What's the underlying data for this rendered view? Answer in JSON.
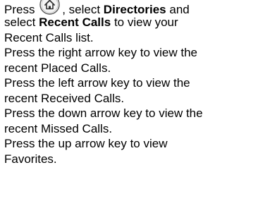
{
  "instructions": {
    "line1": {
      "press": "Press",
      "after_icon": ", select",
      "directories": "Directories",
      "and": "and"
    },
    "line2": {
      "select": "select",
      "recent_calls": "Recent Calls",
      "rest": "to view your"
    },
    "line3": "Recent Calls list.",
    "line4": "Press the right arrow key to view the",
    "line5": "recent Placed Calls.",
    "line6": "Press the left arrow key to view the",
    "line7": "recent Received Calls.",
    "line8": "Press the down arrow key to view the",
    "line9": "recent Missed Calls.",
    "line10": "Press the up arrow key to view",
    "line11": "Favorites."
  },
  "icons": {
    "home": "home-button-icon"
  }
}
